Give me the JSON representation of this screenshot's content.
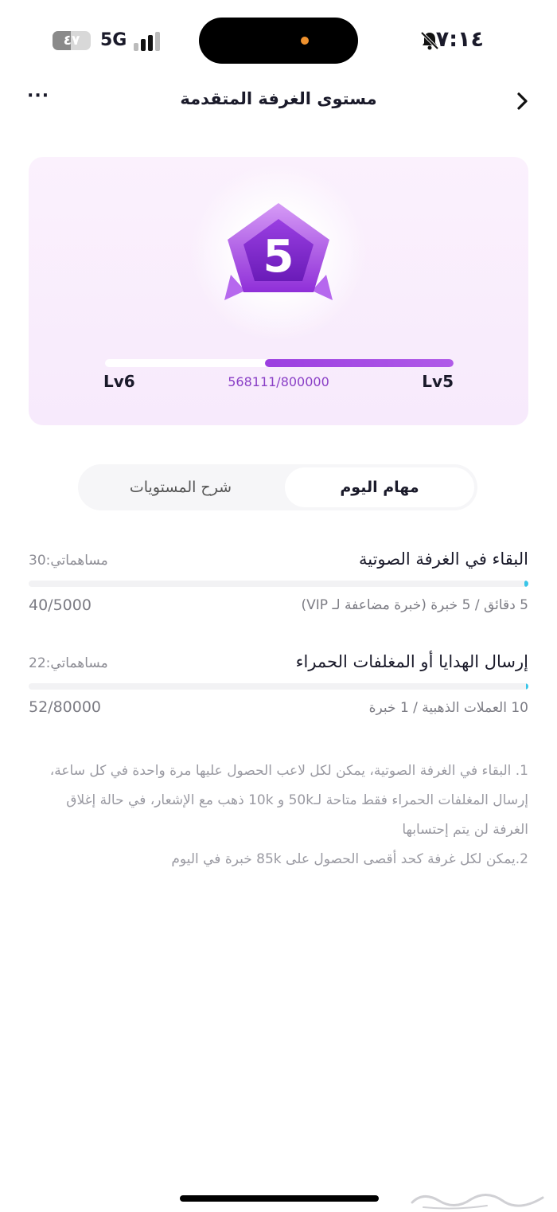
{
  "status_bar": {
    "time": "٧:١٤",
    "battery": "٤٧",
    "battery_level": 0.47,
    "network": "5G"
  },
  "nav": {
    "title": "مستوى الغرفة المتقدمة",
    "more_label": "···"
  },
  "level_card": {
    "badge_level": "5",
    "current_level_label": "Lv5",
    "next_level_label": "Lv6",
    "xp_text": "568111/800000",
    "progress": 0.54
  },
  "tabs": [
    {
      "label": "مهام اليوم",
      "active": true
    },
    {
      "label": "شرح المستويات",
      "active": false
    }
  ],
  "tasks": [
    {
      "title": "البقاء في الغرفة الصوتية",
      "contribution": "مساهماتي:30",
      "description": "5 دقائق / 5 خبرة (خبرة مضاعفة لـ VIP)",
      "progress_text": "40/5000",
      "progress": 0.008
    },
    {
      "title": "إرسال الهدايا أو المغلفات الحمراء",
      "contribution": "مساهماتي:22",
      "description": "10 العملات الذهبية / 1 خبرة",
      "progress_text": "52/80000",
      "progress": 0.0007
    }
  ],
  "notes": [
    "1. البقاء في الغرفة الصوتية، يمكن لكل لاعب الحصول عليها مرة واحدة في كل ساعة، إرسال المغلفات الحمراء فقط متاحة لـ50k و 10k ذهب مع الإشعار، في حالة إغلاق الغرفة لن يتم إحتسابها",
    "2.يمكن لكل غرفة كحد أقصى الحصول على 85k خبرة في اليوم"
  ],
  "colors": {
    "accent_purple": "#9b3fe0",
    "task_bar_cyan": "#39c5e8",
    "card_bg": "#f8ecfc"
  }
}
